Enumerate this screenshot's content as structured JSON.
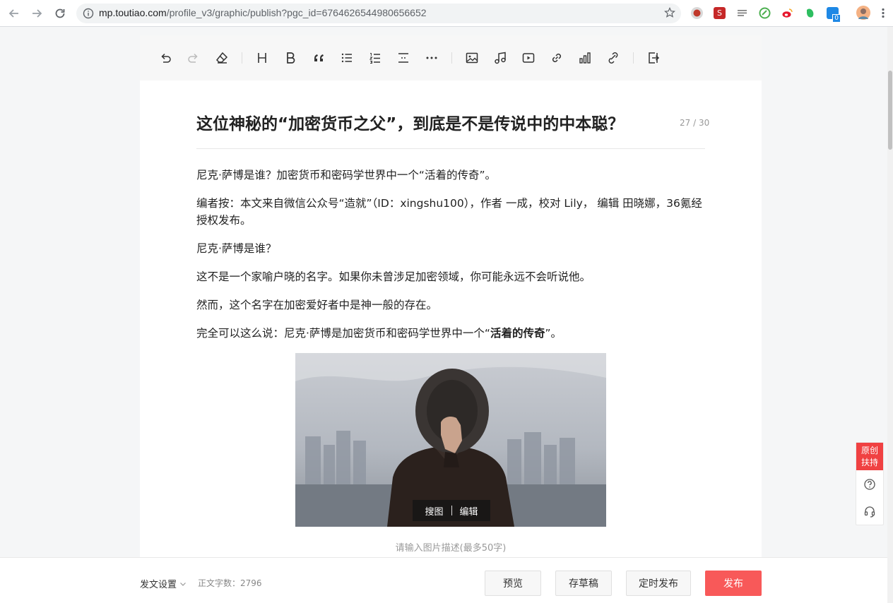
{
  "browser": {
    "url_host": "mp.toutiao.com",
    "url_rest": "/profile_v3/graphic/publish?pgc_id=6764626544980656652",
    "extensions": [
      {
        "name": "record-extension-icon",
        "color": "#c0392b"
      },
      {
        "name": "red-s-extension-icon",
        "color": "#c62828"
      },
      {
        "name": "reader-extension-icon",
        "color": "#777777"
      },
      {
        "name": "green-circle-extension-icon",
        "color": "#4caf50"
      },
      {
        "name": "weibo-extension-icon",
        "color": "#e6162d"
      },
      {
        "name": "evernote-extension-icon",
        "color": "#2dbe60"
      },
      {
        "name": "badge-extension-icon",
        "color": "#1e88e5"
      },
      {
        "name": "avatar-extension-icon",
        "color": "#f4b183"
      }
    ],
    "badge_count": "0"
  },
  "toolbar": {
    "buttons": [
      "undo-icon",
      "redo-icon",
      "clear-format-icon",
      "heading-icon",
      "bold-icon",
      "quote-icon",
      "bullet-list-icon",
      "ordered-list-icon",
      "divider-icon",
      "more-icon",
      "image-icon",
      "music-icon",
      "video-icon",
      "link-icon",
      "chart-icon",
      "link-2-icon",
      "import-icon"
    ]
  },
  "article": {
    "title": "这位神秘的“加密货币之父”，到底是不是传说中的中本聪？",
    "title_count": "27 / 30",
    "paragraphs": {
      "p1": "尼克·萨博是谁？加密货币和密码学世界中一个“活着的传奇”。",
      "p2": "编者按：本文来自微信公众号“造就”（ID：xingshu100），作者 一成，校对 Lily， 编辑 田晓娜，36氪经授权发布。",
      "p3": "尼克·萨博是谁？",
      "p4": "这不是一个家喻户晓的名字。如果你未曾涉足加密领域，你可能永远不会听说他。",
      "p5": "然而，这个名字在加密爱好者中是神一般的存在。",
      "p6_prefix": "完全可以这么说：尼克·萨博是加密货币和密码学世界中一个“",
      "p6_bold": "活着的传奇",
      "p6_suffix": "”。"
    },
    "image_ops": {
      "search": "搜图",
      "edit": "编辑"
    },
    "image_caption_placeholder": "请输入图片描述(最多50字)"
  },
  "footer": {
    "settings_label": "发文设置",
    "wordcount_label": "正文字数：2796",
    "preview": "预览",
    "save_draft": "存草稿",
    "schedule": "定时发布",
    "publish": "发布"
  },
  "float": {
    "tag_line1": "原创",
    "tag_line2": "扶持"
  },
  "colors": {
    "accent": "#f85959",
    "tag": "#f04142"
  }
}
